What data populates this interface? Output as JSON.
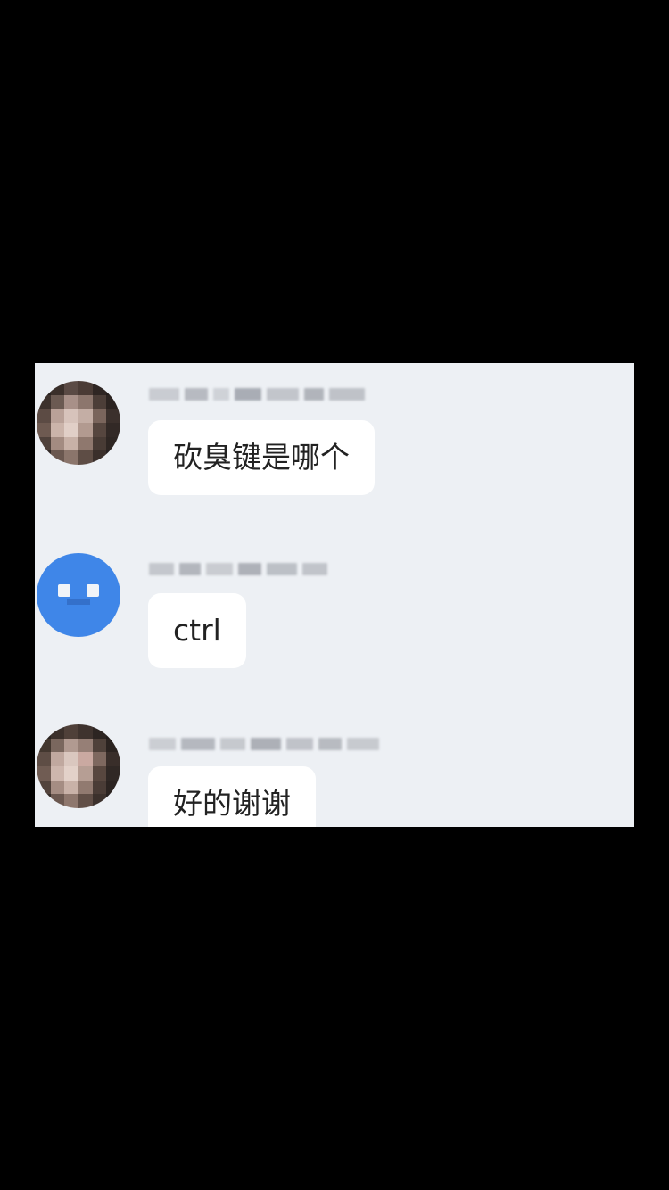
{
  "messages": [
    {
      "sender_avatar": "pixelated-photo-avatar",
      "text": "砍臭键是哪个"
    },
    {
      "sender_avatar": "pixelated-blue-avatar",
      "text": "ctrl"
    },
    {
      "sender_avatar": "pixelated-photo-avatar",
      "text": "好的谢谢"
    }
  ],
  "colors": {
    "background": "#000000",
    "chat_background": "#edf0f4",
    "bubble": "#ffffff",
    "blue_avatar": "#3f86e8",
    "text": "#222222"
  }
}
